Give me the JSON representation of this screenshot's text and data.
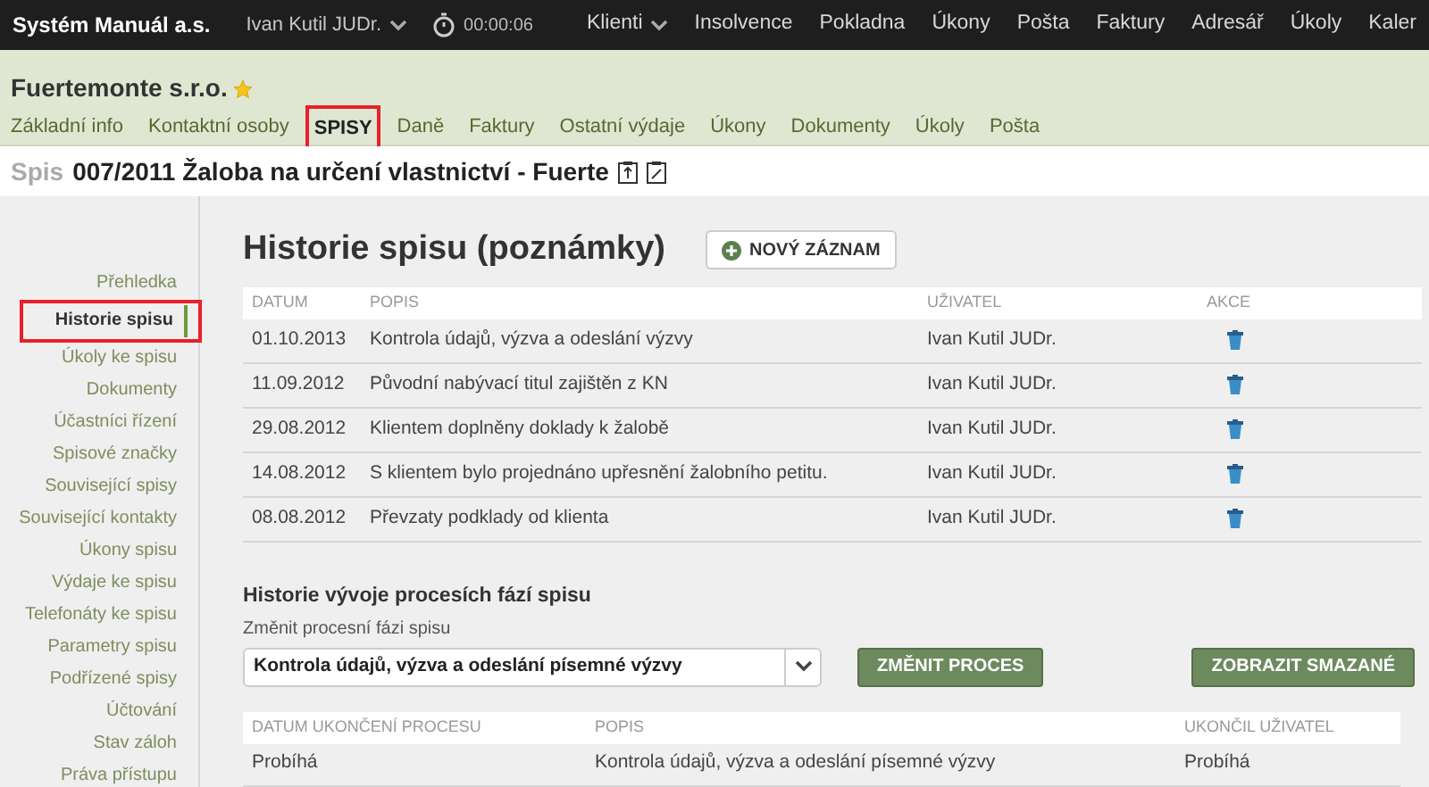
{
  "topbar": {
    "brand": "Systém Manuál a.s.",
    "user": "Ivan Kutil JUDr.",
    "timer": "00:00:06",
    "nav": [
      {
        "label": "Klienti",
        "dropdown": true
      },
      {
        "label": "Insolvence",
        "dropdown": false
      },
      {
        "label": "Pokladna",
        "dropdown": false
      },
      {
        "label": "Úkony",
        "dropdown": false
      },
      {
        "label": "Pošta",
        "dropdown": false
      },
      {
        "label": "Faktury",
        "dropdown": false
      },
      {
        "label": "Adresář",
        "dropdown": false
      },
      {
        "label": "Úkoly",
        "dropdown": false
      },
      {
        "label": "Kaler",
        "dropdown": false
      }
    ]
  },
  "client": {
    "name": "Fuertemonte s.r.o.",
    "favorite": true,
    "tabs": [
      {
        "label": "Základní info",
        "selected": false,
        "highlighted": false
      },
      {
        "label": "Kontaktní osoby",
        "selected": false,
        "highlighted": false
      },
      {
        "label": "SPISY",
        "selected": true,
        "highlighted": true
      },
      {
        "label": "Daně",
        "selected": false,
        "highlighted": false
      },
      {
        "label": "Faktury",
        "selected": false,
        "highlighted": false
      },
      {
        "label": "Ostatní výdaje",
        "selected": false,
        "highlighted": false
      },
      {
        "label": "Úkony",
        "selected": false,
        "highlighted": false
      },
      {
        "label": "Dokumenty",
        "selected": false,
        "highlighted": false
      },
      {
        "label": "Úkoly",
        "selected": false,
        "highlighted": false
      },
      {
        "label": "Pošta",
        "selected": false,
        "highlighted": false
      }
    ]
  },
  "file_title": {
    "prefix": "Spis",
    "title": "007/2011 Žaloba na určení vlastnictví - Fuerte"
  },
  "sidebar": {
    "items": [
      {
        "label": "Přehledka",
        "selected": false,
        "highlighted": false
      },
      {
        "label": "Historie spisu",
        "selected": true,
        "highlighted": true
      },
      {
        "label": "Úkoly ke spisu",
        "selected": false,
        "highlighted": false
      },
      {
        "label": "Dokumenty",
        "selected": false,
        "highlighted": false
      },
      {
        "label": "Účastníci řízení",
        "selected": false,
        "highlighted": false
      },
      {
        "label": "Spisové značky",
        "selected": false,
        "highlighted": false
      },
      {
        "label": "Související spisy",
        "selected": false,
        "highlighted": false
      },
      {
        "label": "Související kontakty",
        "selected": false,
        "highlighted": false
      },
      {
        "label": "Úkony spisu",
        "selected": false,
        "highlighted": false
      },
      {
        "label": "Výdaje ke spisu",
        "selected": false,
        "highlighted": false
      },
      {
        "label": "Telefonáty ke spisu",
        "selected": false,
        "highlighted": false
      },
      {
        "label": "Parametry spisu",
        "selected": false,
        "highlighted": false
      },
      {
        "label": "Podřízené spisy",
        "selected": false,
        "highlighted": false
      },
      {
        "label": "Účtování",
        "selected": false,
        "highlighted": false
      },
      {
        "label": "Stav záloh",
        "selected": false,
        "highlighted": false
      },
      {
        "label": "Práva přístupu",
        "selected": false,
        "highlighted": false
      }
    ]
  },
  "history": {
    "title": "Historie spisu (poznámky)",
    "new_button": "NOVÝ ZÁZNAM",
    "columns": [
      "DATUM",
      "POPIS",
      "UŽIVATEL",
      "AKCE"
    ],
    "rows": [
      {
        "date": "01.10.2013",
        "description": "Kontrola údajů, výzva a odeslání výzvy",
        "user": "Ivan Kutil JUDr."
      },
      {
        "date": "11.09.2012",
        "description": "Původní nabývací titul zajištěn z KN",
        "user": "Ivan Kutil JUDr."
      },
      {
        "date": "29.08.2012",
        "description": "Klientem doplněny doklady k žalobě",
        "user": "Ivan Kutil JUDr."
      },
      {
        "date": "14.08.2012",
        "description": "S klientem bylo projednáno upřesnění žalobního petitu.",
        "user": "Ivan Kutil JUDr."
      },
      {
        "date": "08.08.2012",
        "description": "Převzaty podklady od klienta",
        "user": "Ivan Kutil JUDr."
      }
    ]
  },
  "process": {
    "title": "Historie vývoje procesích fází spisu",
    "select_label": "Změnit procesní fázi spisu",
    "select_value": "Kontrola údajů, výzva a odeslání písemné výzvy",
    "change_button": "ZMĚNIT PROCES",
    "show_deleted_button": "ZOBRAZIT SMAZANÉ",
    "columns": [
      "DATUM UKONČENÍ PROCESU",
      "POPIS",
      "UKONČIL UŽIVATEL"
    ],
    "rows": [
      {
        "end_date": "Probíhá",
        "description": "Kontrola údajů, výzva a odeslání písemné výzvy",
        "user": "Probíhá"
      }
    ]
  }
}
